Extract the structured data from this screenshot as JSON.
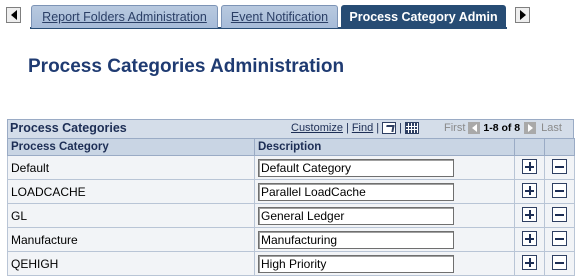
{
  "tabs": [
    {
      "label": "Report Folders Administration"
    },
    {
      "label": "Event Notification"
    },
    {
      "label": "Process Category Admin"
    }
  ],
  "page_title": "Process Categories Administration",
  "grid": {
    "title": "Process Categories",
    "customize_label": "Customize",
    "find_label": "Find",
    "separator": "|",
    "first_label": "First",
    "count_label": "1-8 of 8",
    "last_label": "Last",
    "columns": {
      "category": "Process Category",
      "description": "Description"
    },
    "rows": [
      {
        "category": "Default",
        "description": "Default Category"
      },
      {
        "category": "LOADCACHE",
        "description": "Parallel LoadCache"
      },
      {
        "category": "GL",
        "description": "General Ledger"
      },
      {
        "category": "Manufacture",
        "description": "Manufacturing"
      },
      {
        "category": "QEHIGH",
        "description": "High Priority"
      }
    ]
  },
  "colors": {
    "active_tab": "#274c74",
    "title": "#1f3b72",
    "grid_header": "#d4dde9"
  },
  "icons": [
    "scroll-left-icon",
    "scroll-right-icon",
    "zoom-icon",
    "download-grid-icon",
    "previous-icon",
    "next-icon",
    "add-row-icon",
    "delete-row-icon"
  ]
}
